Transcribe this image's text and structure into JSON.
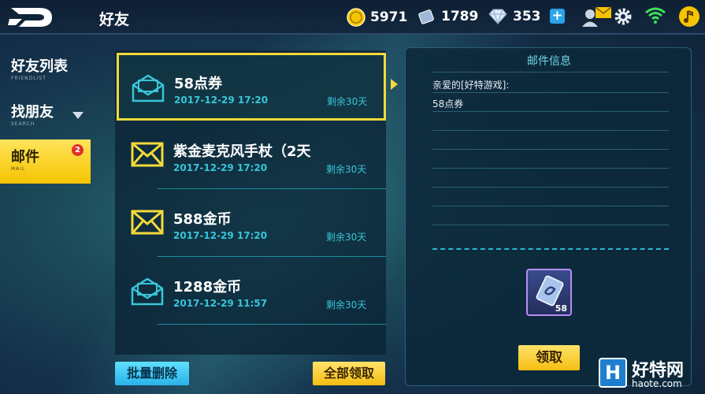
{
  "header": {
    "title": "好友",
    "gold": "5971",
    "cards": "1789",
    "diamonds": "353",
    "plus_label": "+"
  },
  "sidebar": {
    "items": [
      {
        "label": "好友列表",
        "sub": "FRIENDLIST"
      },
      {
        "label": "找朋友",
        "sub": "SEARCH"
      },
      {
        "label": "邮件",
        "sub": "MAIL",
        "badge": "2"
      }
    ]
  },
  "mails": [
    {
      "title": "58点券",
      "date": "2017-12-29 17:20",
      "remain": "剩余30天",
      "icon": "open-envelope-icon"
    },
    {
      "title": "紫金麦克风手杖（2天",
      "date": "2017-12-29 17:20",
      "remain": "剩余30天",
      "icon": "envelope-icon"
    },
    {
      "title": "588金币",
      "date": "2017-12-29 17:20",
      "remain": "剩余30天",
      "icon": "envelope-icon"
    },
    {
      "title": "1288金币",
      "date": "2017-12-29 11:57",
      "remain": "剩余30天",
      "icon": "open-envelope-icon"
    }
  ],
  "detail": {
    "heading": "邮件信息",
    "greeting": "亲爱的[好特游戏]:",
    "content": "58点券",
    "item_count": "58",
    "claim_label": "领取"
  },
  "buttons": {
    "batch_delete": "批量删除",
    "claim_all": "全部领取"
  },
  "watermark": {
    "letter": "H",
    "name": "好特网",
    "url": "haote.com"
  },
  "colors": {
    "accent_yellow": "#f3d93a",
    "accent_cyan": "#38c6d8",
    "button_blue": "#2ab3e8"
  }
}
